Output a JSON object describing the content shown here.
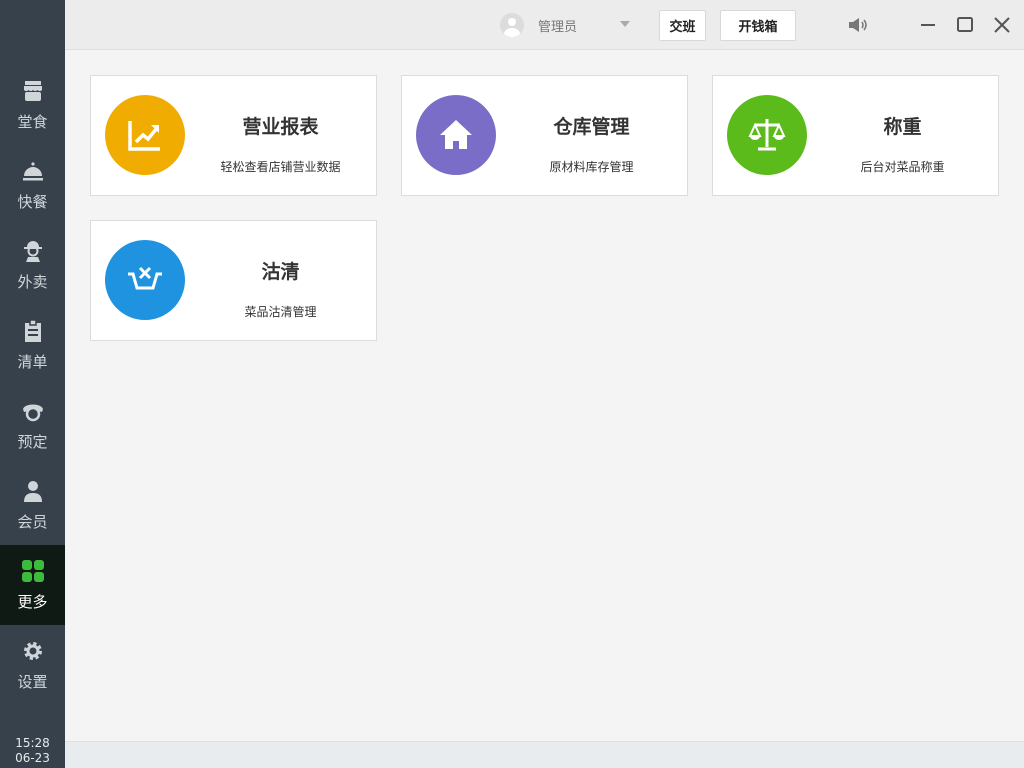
{
  "sidebar": {
    "items": [
      {
        "label": "堂食",
        "icon": "store-icon"
      },
      {
        "label": "快餐",
        "icon": "cloche-icon"
      },
      {
        "label": "外卖",
        "icon": "delivery-person-icon"
      },
      {
        "label": "清单",
        "icon": "clipboard-icon"
      },
      {
        "label": "预定",
        "icon": "phone-icon"
      },
      {
        "label": "会员",
        "icon": "member-icon"
      },
      {
        "label": "更多",
        "icon": "grid-icon",
        "active": true
      },
      {
        "label": "设置",
        "icon": "gear-icon"
      }
    ],
    "time": "15:28",
    "date": "06-23"
  },
  "topbar": {
    "user": "管理员",
    "shift_button": "交班",
    "cash_drawer_button": "开钱箱"
  },
  "cards": [
    {
      "title": "营业报表",
      "subtitle": "轻松查看店铺营业数据",
      "color": "#f0ac00",
      "icon": "chart-up-icon"
    },
    {
      "title": "仓库管理",
      "subtitle": "原材料库存管理",
      "color": "#7a6dc8",
      "icon": "house-icon"
    },
    {
      "title": "称重",
      "subtitle": "后台对菜品称重",
      "color": "#5bbb1a",
      "icon": "scale-icon"
    },
    {
      "title": "沽清",
      "subtitle": "菜品沽清管理",
      "color": "#1f93e0",
      "icon": "basket-x-icon"
    }
  ]
}
